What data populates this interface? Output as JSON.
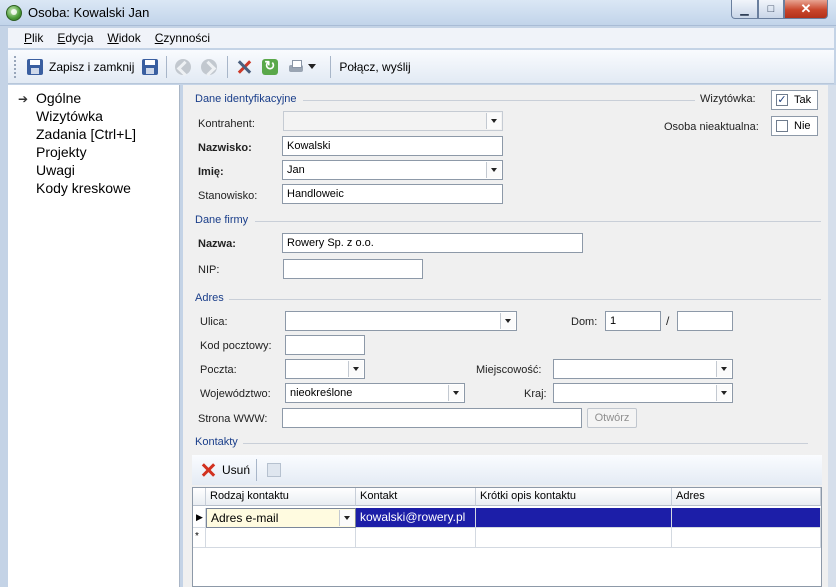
{
  "window": {
    "title": "Osoba: Kowalski Jan"
  },
  "menu": [
    "Plik",
    "Edycja",
    "Widok",
    "Czynności"
  ],
  "toolbar": {
    "save_close": "Zapisz i zamknij",
    "connect_send": "Połącz, wyślij"
  },
  "nav": [
    "Ogólne",
    "Wizytówka",
    "Zadania [Ctrl+L]",
    "Projekty",
    "Uwagi",
    "Kody kreskowe"
  ],
  "ident": {
    "title": "Dane identyfikacyjne",
    "kontrahent_label": "Kontrahent:",
    "kontrahent_value": "",
    "nazwisko_label": "Nazwisko:",
    "nazwisko_value": "Kowalski",
    "imie_label": "Imię:",
    "imie_value": "Jan",
    "stanowisko_label": "Stanowisko:",
    "stanowisko_value": "Handloweic",
    "wizytowka_label": "Wizytówka:",
    "wizytowka_value": "Tak",
    "nieaktualna_label": "Osoba nieaktualna:",
    "nieaktualna_value": "Nie"
  },
  "firma": {
    "title": "Dane firmy",
    "nazwa_label": "Nazwa:",
    "nazwa_value": "Rowery Sp. z o.o.",
    "nip_label": "NIP:",
    "nip_value": ""
  },
  "adres": {
    "title": "Adres",
    "ulica_label": "Ulica:",
    "ulica_value": "",
    "dom_label": "Dom:",
    "dom_value": "1",
    "slash": "/",
    "lokal_value": "",
    "kod_label": "Kod pocztowy:",
    "kod_value": "",
    "poczta_label": "Poczta:",
    "poczta_value": "",
    "miejscowosc_label": "Miejscowość:",
    "miejscowosc_value": "",
    "woj_label": "Województwo:",
    "woj_value": "nieokreślone",
    "kraj_label": "Kraj:",
    "kraj_value": "",
    "www_label": "Strona WWW:",
    "www_value": "",
    "otworz": "Otwórz"
  },
  "kontakty": {
    "title": "Kontakty",
    "usun": "Usuń",
    "columns": [
      "Rodzaj kontaktu",
      "Kontakt",
      "Krótki opis kontaktu",
      "Adres"
    ],
    "rows": [
      {
        "rodzaj": "Adres e-mail",
        "kontakt": "kowalski@rowery.pl",
        "opis": "",
        "adres": ""
      }
    ],
    "new_row_marker": "*"
  }
}
